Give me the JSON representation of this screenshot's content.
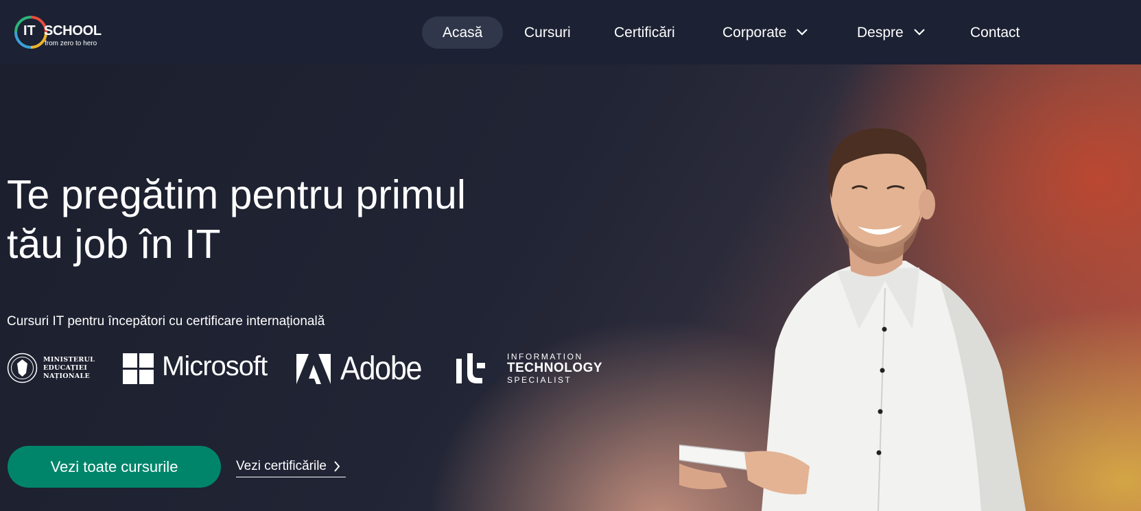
{
  "logo": {
    "it": "IT",
    "school": "SCHOOL",
    "tagline": "from zero to hero"
  },
  "nav": {
    "items": [
      {
        "label": "Acasă",
        "active": true
      },
      {
        "label": "Cursuri"
      },
      {
        "label": "Certificări"
      },
      {
        "label": "Corporate",
        "dropdown": true
      },
      {
        "label": "Despre",
        "dropdown": true
      },
      {
        "label": "Contact"
      }
    ]
  },
  "hero": {
    "title_line1": "Te pregătim pentru primul",
    "title_line2": "tău job în IT",
    "subtitle": "Cursuri IT pentru începători cu certificare internațională",
    "partners": {
      "men_line1": "MINISTERUL",
      "men_line2": "EDUCAȚIEI",
      "men_line3": "NAȚIONALE",
      "microsoft": "Microsoft",
      "adobe": "Adobe",
      "its_line1": "INFORMATION",
      "its_line2": "TECHNOLOGY",
      "its_line3": "SPECIALIST"
    },
    "primary_button": "Vezi toate cursurile",
    "secondary_link": "Vezi certificările"
  },
  "colors": {
    "header_bg": "#1c2133",
    "active_nav_bg": "#30374a",
    "primary_button": "#00856b"
  }
}
